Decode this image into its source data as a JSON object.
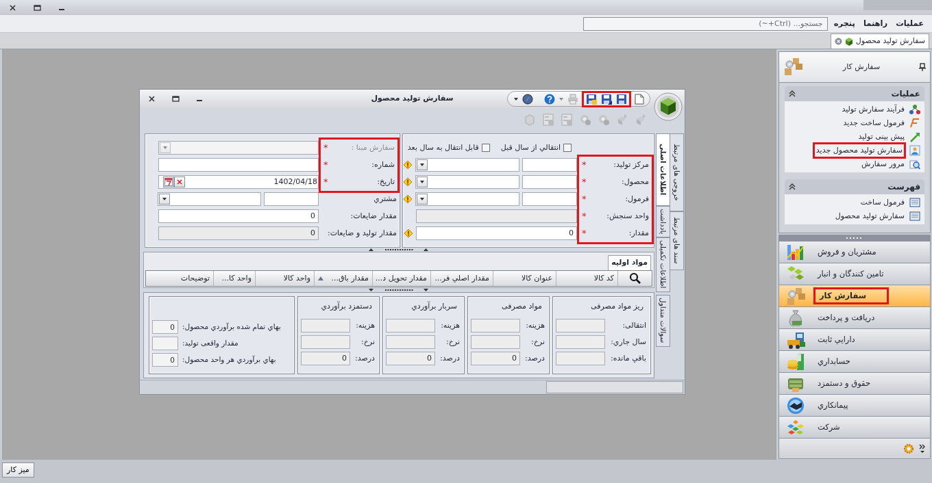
{
  "menu": [
    {
      "label": "عملیات"
    },
    {
      "label": "راهنما"
    },
    {
      "label": "پنجره"
    }
  ],
  "search": {
    "placeholder": "جستجو... (Ctrl+~)"
  },
  "doc_tabs": [
    {
      "label": "سفارش تولید محصول",
      "selected": true
    }
  ],
  "dialog": {
    "title": "سفارش تولید محصول",
    "save_buttons_highlighted": true,
    "right_panel": {
      "checkboxes": [
        {
          "label": "انتقالي از سال قبل",
          "checked": false
        },
        {
          "label": "قابل انتقال به سال بعد",
          "checked": false
        }
      ],
      "fields": [
        {
          "label": "مرکز تولید:",
          "required_mark": "*",
          "kind": "lookup",
          "highlighted": true
        },
        {
          "label": "محصول:",
          "required_mark": "*",
          "kind": "lookup",
          "highlighted": true
        },
        {
          "label": "فرمول:",
          "required_mark": "*",
          "kind": "lookup",
          "highlighted": true
        },
        {
          "label": "واحد سنجش:",
          "required_mark": "*",
          "kind": "readonly",
          "highlighted": true
        },
        {
          "label": "مقدار:",
          "required_mark": "*",
          "kind": "number",
          "value": "0",
          "highlighted": true
        }
      ]
    },
    "left_panel": {
      "fields": [
        {
          "label": "سفارش مبنا :",
          "required_mark": "*",
          "kind": "combo",
          "disabled": true,
          "highlighted": true
        },
        {
          "label": "شماره:",
          "required_mark": "*",
          "kind": "text",
          "highlighted": true
        },
        {
          "label": "تاریخ:",
          "required_mark": "*",
          "kind": "date",
          "value": "1402/04/18",
          "highlighted": true
        },
        {
          "label": "مشتري",
          "kind": "lookup",
          "highlighted": false
        },
        {
          "label": "مقدار ضایعات:",
          "kind": "number",
          "value": "0",
          "highlighted": false
        },
        {
          "label": "مقدار تولید و ضایعات:",
          "kind": "readonly",
          "value": "0",
          "highlighted": false
        }
      ]
    },
    "grid": {
      "tab": "مواد اولیه",
      "columns": [
        {
          "label": "کد کالا",
          "sorted": false
        },
        {
          "label": "عنوان کالا",
          "sorted": false
        },
        {
          "label": "مقدار اصلي فر...",
          "sorted": false
        },
        {
          "label": "مقدار تحویل د...",
          "sorted": false
        },
        {
          "label": "مقدار باق...",
          "sorted": true
        },
        {
          "label": "واحد کالا",
          "sorted": false
        },
        {
          "label": "واحد کا...",
          "sorted": false
        },
        {
          "label": "توضیحات",
          "sorted": false
        }
      ]
    },
    "summary": [
      {
        "title": "ریز مواد مصرفی",
        "rows": [
          {
            "label": "انتقالی:"
          },
          {
            "label": "سال جاري:"
          },
          {
            "label": "باقي مانده:"
          }
        ]
      },
      {
        "title": "مواد مصرفی",
        "rows": [
          {
            "label": "هزینه:"
          },
          {
            "label": "نرخ:"
          },
          {
            "label": "درصد:",
            "value": "0"
          }
        ]
      },
      {
        "title": "سربار برآوردي",
        "rows": [
          {
            "label": "هزینه:"
          },
          {
            "label": "نرخ:"
          },
          {
            "label": "درصد:",
            "value": "0"
          }
        ]
      },
      {
        "title": "دستمزد برآوردي",
        "rows": [
          {
            "label": "هزینه:"
          },
          {
            "label": "نرخ:"
          },
          {
            "label": "درصد:",
            "value": "0"
          }
        ]
      },
      {
        "rows": [
          {
            "label": "بهاي تمام شده برآوردي محصول:",
            "value": "0"
          },
          {
            "label": "مقدار واقعی تولید:"
          },
          {
            "label": "بهاي برآوردي هر واحد محصول:",
            "value": "0"
          }
        ]
      }
    ],
    "side_tab_rows": [
      {
        "tabs": [
          {
            "label": "اطلاعات اصلی",
            "selected": true
          },
          {
            "label": "یادداشت",
            "selected": false
          },
          {
            "label": "اطلاعات تکمیلی",
            "selected": false
          },
          {
            "label": "سوالات متداول",
            "selected": false
          }
        ]
      },
      {
        "tabs": [
          {
            "label": "خروجی های مرتبط",
            "selected": false
          },
          {
            "label": "سند های مرتبط",
            "selected": false
          }
        ]
      }
    ]
  },
  "sidebar": {
    "title": "سفارش کار",
    "groups": [
      {
        "title": "عملیات",
        "expanded": true,
        "items": [
          {
            "label": "فرآیند سفارش تولید",
            "highlighted": false
          },
          {
            "label": "فرمول ساخت جدید",
            "highlighted": false
          },
          {
            "label": "پیش بینی تولید",
            "highlighted": false
          },
          {
            "label": "سفارش تولید محصول جدید",
            "highlighted": true
          },
          {
            "label": "مرور سفارش",
            "highlighted": false
          }
        ]
      },
      {
        "title": "فهرست",
        "expanded": true,
        "items": [
          {
            "label": "فرمول ساخت",
            "highlighted": false
          },
          {
            "label": "سفارش تولید محصول",
            "highlighted": false
          }
        ]
      }
    ],
    "modules": [
      {
        "label": "مشتریان و فروش",
        "selected": false,
        "highlighted": false
      },
      {
        "label": "تامین کنندگان و انبار",
        "selected": false,
        "highlighted": false
      },
      {
        "label": "سفارش کار",
        "selected": true,
        "highlighted": true
      },
      {
        "label": "دریافت و پرداخت",
        "selected": false,
        "highlighted": false
      },
      {
        "label": "دارايي ثابت",
        "selected": false,
        "highlighted": false
      },
      {
        "label": "حسابداري",
        "selected": false,
        "highlighted": false
      },
      {
        "label": "حقوق و دستمزد",
        "selected": false,
        "highlighted": false
      },
      {
        "label": "پیمانکاري",
        "selected": false,
        "highlighted": false
      },
      {
        "label": "شرکت",
        "selected": false,
        "highlighted": false
      }
    ]
  },
  "taskbar": {
    "button": "میز کار"
  }
}
